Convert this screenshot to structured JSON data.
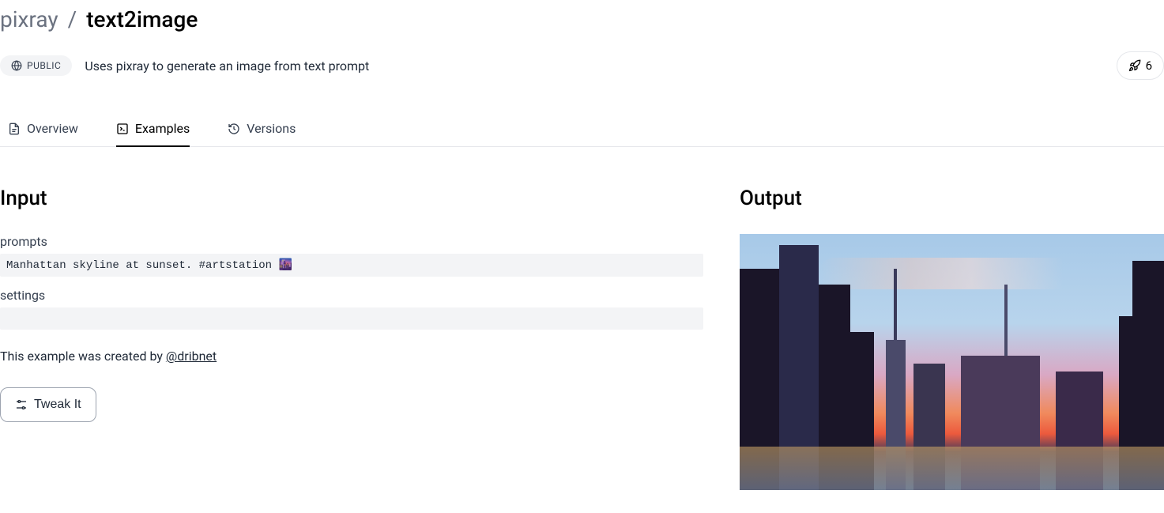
{
  "breadcrumb": {
    "owner": "pixray",
    "separator": "/",
    "name": "text2image"
  },
  "visibility": {
    "label": "PUBLIC"
  },
  "description": "Uses pixray to generate an image from text prompt",
  "runs": {
    "count": "6"
  },
  "tabs": [
    {
      "id": "overview",
      "label": "Overview"
    },
    {
      "id": "examples",
      "label": "Examples"
    },
    {
      "id": "versions",
      "label": "Versions"
    }
  ],
  "active_tab": "examples",
  "input": {
    "heading": "Input",
    "fields": [
      {
        "label": "prompts",
        "value": "Manhattan skyline at sunset. #artstation 🌆"
      },
      {
        "label": "settings",
        "value": ""
      }
    ],
    "creator_prefix": "This example was created by ",
    "creator_handle": "@dribnet",
    "tweak_label": "Tweak It"
  },
  "output": {
    "heading": "Output"
  }
}
